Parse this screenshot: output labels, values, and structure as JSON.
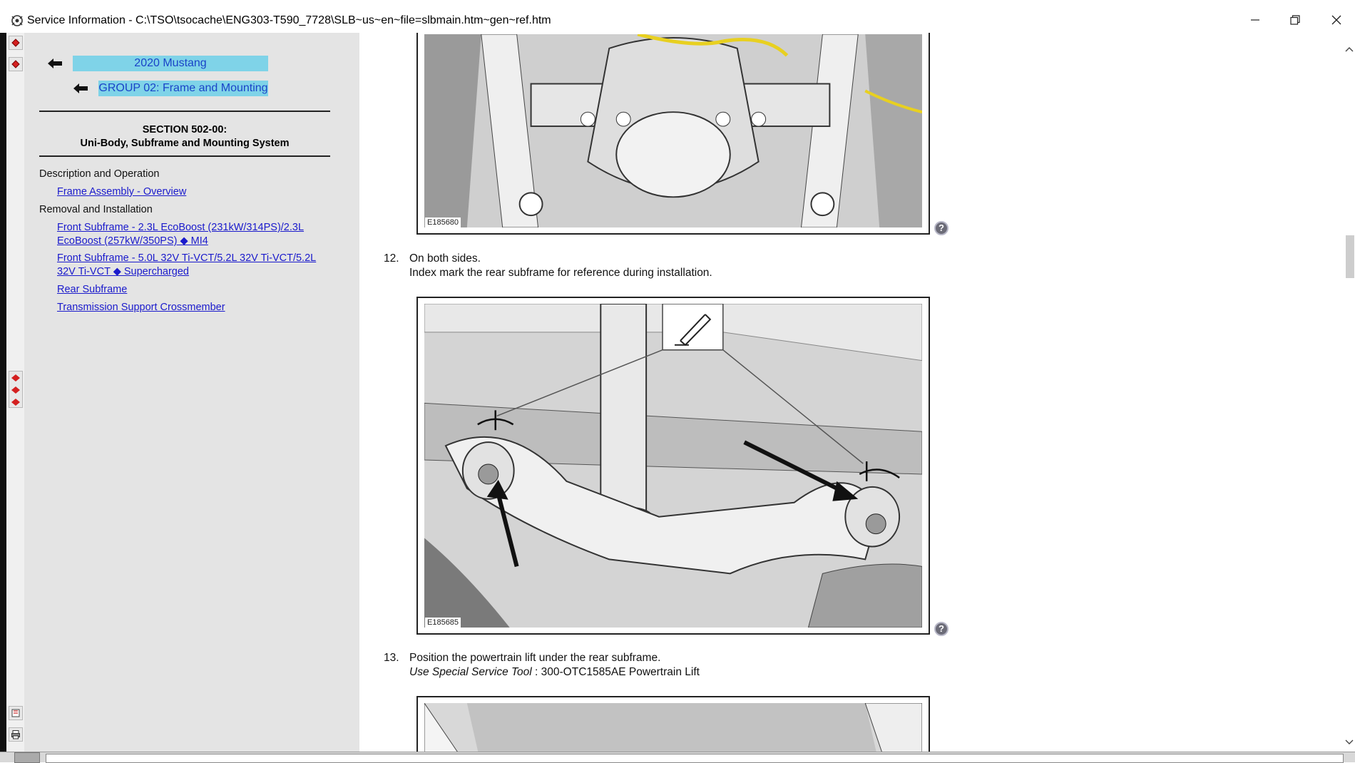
{
  "window": {
    "title": "Service Information - C:\\TSO\\tsocache\\ENG303-T590_7728\\SLB~us~en~file=slbmain.htm~gen~ref.htm"
  },
  "nav": {
    "vehicle_crumb": "2020 Mustang",
    "group_crumb": "GROUP 02: Frame and Mounting",
    "section_line1": "SECTION 502-00:",
    "section_line2": "Uni-Body, Subframe and Mounting System",
    "category_description": "Description and Operation",
    "link_frame_overview": "Frame Assembly - Overview",
    "category_removal": "Removal and Installation",
    "link_front_subframe_23_l1": "Front Subframe - 2.3L EcoBoost (231kW/314PS)/2.3L",
    "link_front_subframe_23_l2": "EcoBoost (257kW/350PS) ◆ MI4",
    "link_front_subframe_50_l1": "Front Subframe - 5.0L 32V Ti-VCT/5.2L 32V Ti-VCT/5.2L",
    "link_front_subframe_50_l2": "32V Ti-VCT ◆ Supercharged",
    "link_rear_subframe": "Rear Subframe",
    "link_transmission_crossmember": "Transmission Support Crossmember"
  },
  "content": {
    "figure1_id": "E185680",
    "step12_number": "12.",
    "step12_line1": "On both sides.",
    "step12_line2": "Index mark the rear subframe for reference during installation.",
    "figure2_id": "E185685",
    "step13_number": "13.",
    "step13_line1": "Position the powertrain lift under the rear subframe.",
    "step13_tool_label": "Use Special Service Tool",
    "step13_tool_value": " : 300-OTC1585AE Powertrain Lift",
    "help_glyph": "?"
  },
  "icons": {
    "back": "back-arrow-icon",
    "help": "help-icon",
    "minimize": "minimize-icon",
    "maximize": "restore-icon",
    "close": "close-icon"
  },
  "colors": {
    "crumb_bg": "#7fd3e8",
    "link": "#1a1acc",
    "nav_bg": "#e4e4e4"
  }
}
